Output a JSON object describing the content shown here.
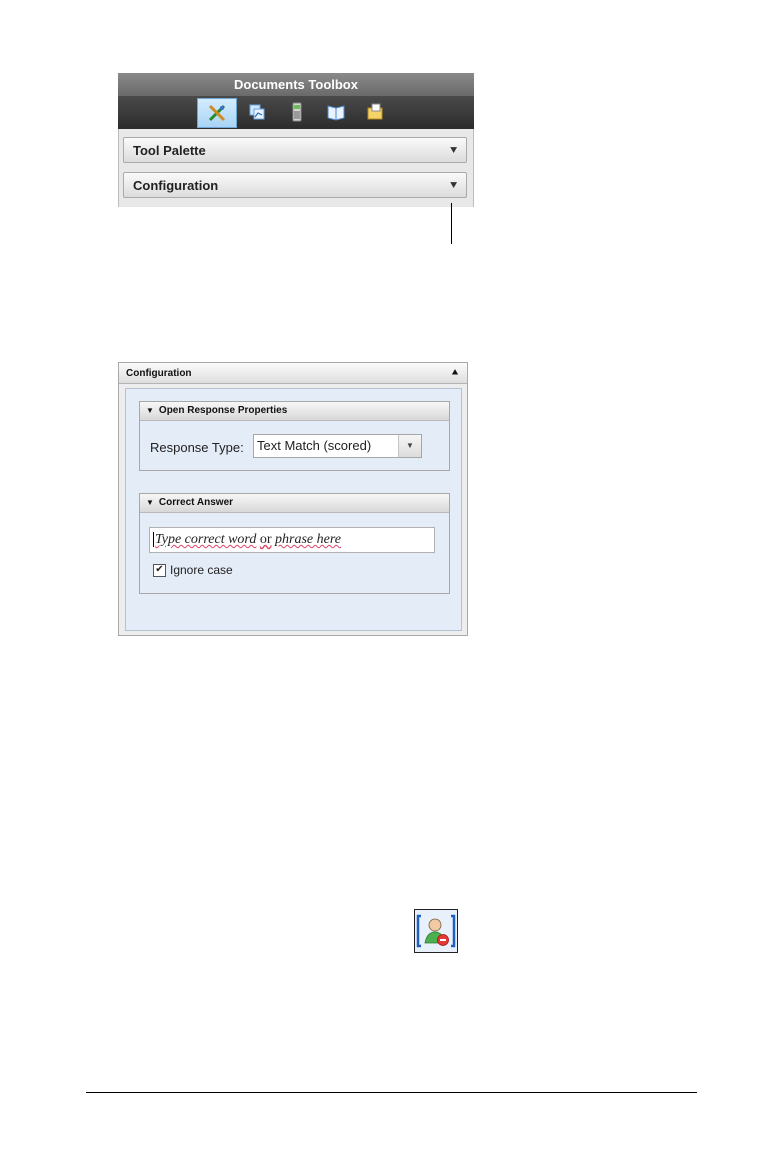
{
  "toolbox": {
    "title": "Documents Toolbox",
    "icons": [
      "tools-icon",
      "page-sorter-icon",
      "calculator-emulator-icon",
      "content-explorer-icon",
      "utilities-icon"
    ],
    "sections": [
      {
        "label": "Tool Palette"
      },
      {
        "label": "Configuration"
      }
    ]
  },
  "config": {
    "header": "Configuration",
    "open_response": {
      "title": "Open Response Properties",
      "response_type_label": "Response Type:",
      "response_type_value": "Text Match (scored)"
    },
    "correct_answer": {
      "title": "Correct Answer",
      "placeholder_part1": "Type correct word",
      "placeholder_or": "or",
      "placeholder_part2": "phrase here",
      "ignore_case_label": "Ignore case",
      "ignore_case_checked": true
    }
  },
  "icon": {
    "name": "student-response-icon"
  }
}
